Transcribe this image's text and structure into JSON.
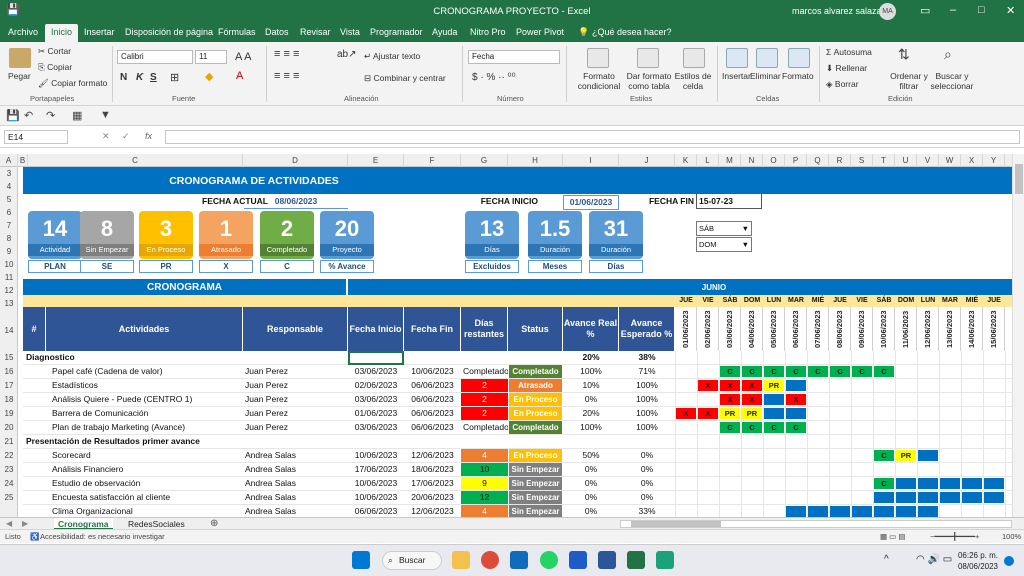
{
  "window": {
    "title": "CRONOGRAMA PROYECTO  -  Excel",
    "user": "marcos alvarez salazar",
    "avatar": "MA"
  },
  "menu": [
    "Archivo",
    "Inicio",
    "Insertar",
    "Disposición de página",
    "Fórmulas",
    "Datos",
    "Revisar",
    "Vista",
    "Programador",
    "Ayuda",
    "Nitro Pro",
    "Power Pivot",
    "¿Qué desea hacer?"
  ],
  "ribbon": {
    "paste": "Pegar",
    "cut": "Cortar",
    "copy": "Copiar",
    "format_painter": "Copiar formato",
    "font_name": "Calibri",
    "font_size": "11",
    "bold": "N",
    "italic": "K",
    "underline": "S",
    "wrap": "Ajustar texto",
    "merge": "Combinar y centrar",
    "number_format": "Fecha",
    "cond_format": "Formato condicional",
    "format_table": "Dar formato como tabla",
    "cell_styles": "Estilos de celda",
    "insert": "Insertar",
    "delete": "Eliminar",
    "format": "Formato",
    "autosum": "Autosuma",
    "fill": "Rellenar",
    "clear": "Borrar",
    "sort": "Ordenar y filtrar",
    "find": "Buscar y seleccionar",
    "groups": [
      "Portapapeles",
      "Fuente",
      "Alineación",
      "Número",
      "Estilos",
      "Celdas",
      "Edición"
    ]
  },
  "formula": {
    "namebox": "E14",
    "fx": "fx",
    "value": ""
  },
  "columns": [
    "A",
    "B",
    "C",
    "D",
    "E",
    "F",
    "G",
    "H",
    "I",
    "J",
    "K",
    "L",
    "M",
    "N",
    "O",
    "P",
    "Q",
    "R",
    "S",
    "T",
    "U",
    "V",
    "W",
    "X",
    "Y"
  ],
  "rows": [
    "3",
    "4",
    "5",
    "6",
    "7",
    "8",
    "9",
    "10",
    "11",
    "12",
    "13",
    "14",
    "15",
    "16",
    "17",
    "18",
    "19",
    "20",
    "21",
    "22",
    "23",
    "24",
    "25"
  ],
  "sheet": {
    "title": "CRONOGRAMA DE ACTIVIDADES",
    "fecha_actual_label": "FECHA ACTUAL",
    "fecha_actual": "08/06/2023",
    "fecha_inicio_label": "FECHA INICIO",
    "fecha_inicio": "01/06/2023",
    "fecha_fin_label": "FECHA FIN",
    "fecha_fin": "15-07-23",
    "dropdown1": "SÁB",
    "dropdown2": "DOM",
    "cards": [
      {
        "num": "14",
        "label": "Actividad",
        "sub": "PLAN",
        "color": "#5b9bd5",
        "band": "#2e75b6"
      },
      {
        "num": "8",
        "label": "Sin Empezar",
        "sub": "SE",
        "color": "#a6a6a6",
        "band": "#7f7f7f"
      },
      {
        "num": "3",
        "label": "En Proceso",
        "sub": "PR",
        "color": "#ffc000",
        "band": "#e6a800"
      },
      {
        "num": "1",
        "label": "Atrasado",
        "sub": "X",
        "color": "#f4a460",
        "band": "#ed7d31"
      },
      {
        "num": "2",
        "label": "Completado",
        "sub": "C",
        "color": "#70ad47",
        "band": "#548235"
      },
      {
        "num": "20",
        "label": "Proyecto",
        "sub": "% Avance",
        "color": "#5b9bd5",
        "band": "#2e75b6"
      },
      {
        "num": "13",
        "label": "Días",
        "sub": "Excluidos",
        "color": "#5b9bd5",
        "band": "#2e75b6"
      },
      {
        "num": "1.5",
        "label": "Duración",
        "sub": "Meses",
        "color": "#5b9bd5",
        "band": "#2e75b6"
      },
      {
        "num": "31",
        "label": "Duración",
        "sub": "Días",
        "color": "#5b9bd5",
        "band": "#2e75b6"
      }
    ],
    "section": "CRONOGRAMA",
    "month": "JUNIO",
    "days": [
      "JUE",
      "VIE",
      "SÁB",
      "DOM",
      "LUN",
      "MAR",
      "MIÉ",
      "JUE",
      "VIE",
      "SÁB",
      "DOM",
      "LUN",
      "MAR",
      "MIÉ",
      "JUE"
    ],
    "dates": [
      "01/06/2023",
      "02/06/2023",
      "03/06/2023",
      "04/06/2023",
      "05/06/2023",
      "06/06/2023",
      "07/06/2023",
      "08/06/2023",
      "09/06/2023",
      "10/06/2023",
      "11/06/2023",
      "12/06/2023",
      "13/06/2023",
      "14/06/2023",
      "15/06/2023"
    ],
    "headers": [
      "#",
      "Actividades",
      "Responsable",
      "Fecha Inicio",
      "Fecha Fin",
      "Días restantes",
      "Status",
      "Avance Real %",
      "Avance Esperado %"
    ],
    "tasks": [
      {
        "act": "Diagnostico",
        "resp": "",
        "ini": "",
        "fin": "",
        "dias": "",
        "status": "",
        "real": "20%",
        "esp": "38%",
        "group": true,
        "gantt": []
      },
      {
        "act": "Papel café (Cadena de valor)",
        "resp": "Juan Perez",
        "ini": "03/06/2023",
        "fin": "10/06/2023",
        "dias": "Completado",
        "status": "Completado",
        "real": "100%",
        "esp": "71%",
        "gantt": [
          "",
          "",
          "C",
          "C",
          "C",
          "C",
          "C",
          "C",
          "C",
          "C",
          "",
          "",
          "",
          "",
          ""
        ]
      },
      {
        "act": "Estadísticos",
        "resp": "Juan Perez",
        "ini": "02/06/2023",
        "fin": "06/06/2023",
        "dias": "2",
        "status": "Atrasado",
        "real": "10%",
        "esp": "100%",
        "gantt": [
          "",
          "X",
          "X",
          "X",
          "PR",
          "B",
          "",
          "",
          "",
          "",
          "",
          "",
          "",
          "",
          ""
        ]
      },
      {
        "act": "Análisis Quiere - Puede (CENTRO 1)",
        "resp": "Juan Perez",
        "ini": "03/06/2023",
        "fin": "06/06/2023",
        "dias": "2",
        "status": "En Proceso",
        "real": "0%",
        "esp": "100%",
        "gantt": [
          "",
          "",
          "X",
          "X",
          "B",
          "X",
          "",
          "",
          "",
          "",
          "",
          "",
          "",
          "",
          ""
        ]
      },
      {
        "act": "Barrera de Comunicación",
        "resp": "Juan Perez",
        "ini": "01/06/2023",
        "fin": "06/06/2023",
        "dias": "2",
        "status": "En Proceso",
        "real": "20%",
        "esp": "100%",
        "gantt": [
          "X",
          "X",
          "PR",
          "PR",
          "B",
          "B",
          "",
          "",
          "",
          "",
          "",
          "",
          "",
          "",
          ""
        ]
      },
      {
        "act": "Plan de trabajo Marketing (Avance)",
        "resp": "Juan Perez",
        "ini": "03/06/2023",
        "fin": "06/06/2023",
        "dias": "Completado",
        "status": "Completado",
        "real": "100%",
        "esp": "100%",
        "gantt": [
          "",
          "",
          "C",
          "C",
          "C",
          "C",
          "",
          "",
          "",
          "",
          "",
          "",
          "",
          "",
          ""
        ]
      },
      {
        "act": "Presentación de Resultados primer avance",
        "resp": "",
        "ini": "",
        "fin": "",
        "dias": "",
        "status": "",
        "real": "",
        "esp": "",
        "group": true,
        "gantt": []
      },
      {
        "act": "Scorecard",
        "resp": "Andrea Salas",
        "ini": "10/06/2023",
        "fin": "12/06/2023",
        "dias": "4",
        "status": "En Proceso",
        "real": "50%",
        "esp": "0%",
        "gantt": [
          "",
          "",
          "",
          "",
          "",
          "",
          "",
          "",
          "",
          "C",
          "PR",
          "B",
          "",
          "",
          ""
        ]
      },
      {
        "act": "Análisis Financiero",
        "resp": "Andrea Salas",
        "ini": "17/06/2023",
        "fin": "18/06/2023",
        "dias": "10",
        "status": "Sin Empezar",
        "real": "0%",
        "esp": "0%",
        "gantt": []
      },
      {
        "act": "Estudio de observación",
        "resp": "Andrea Salas",
        "ini": "10/06/2023",
        "fin": "17/06/2023",
        "dias": "9",
        "status": "Sin Empezar",
        "real": "0%",
        "esp": "0%",
        "gantt": [
          "",
          "",
          "",
          "",
          "",
          "",
          "",
          "",
          "",
          "C",
          "B",
          "B",
          "B",
          "B",
          "B"
        ]
      },
      {
        "act": "Encuesta satisfacción al cliente",
        "resp": "Andrea Salas",
        "ini": "10/06/2023",
        "fin": "20/06/2023",
        "dias": "12",
        "status": "Sin Empezar",
        "real": "0%",
        "esp": "0%",
        "gantt": [
          "",
          "",
          "",
          "",
          "",
          "",
          "",
          "",
          "",
          "B",
          "B",
          "B",
          "B",
          "B",
          "B"
        ]
      },
      {
        "act": "Clima Organizacional",
        "resp": "Andrea Salas",
        "ini": "06/06/2023",
        "fin": "12/06/2023",
        "dias": "4",
        "status": "Sin Empezar",
        "real": "0%",
        "esp": "33%",
        "gantt": [
          "",
          "",
          "",
          "",
          "",
          "B",
          "B",
          "B",
          "B",
          "B",
          "B",
          "B",
          "",
          "",
          ""
        ]
      }
    ]
  },
  "sheet_tabs": [
    "Cronograma",
    "RedesSociales"
  ],
  "status": {
    "ready": "Listo",
    "accessibility": "Accesibilidad: es necesario investigar",
    "zoom": "100%"
  },
  "taskbar": {
    "search": "Buscar",
    "time": "06:26 p. m.",
    "date": "08/06/2023"
  },
  "colors": {
    "excel_green": "#217346",
    "header_blue": "#2f5597",
    "bar_blue": "#0070c0",
    "done": "#00b050",
    "late": "#ff0000",
    "progress": "#ffff00"
  }
}
